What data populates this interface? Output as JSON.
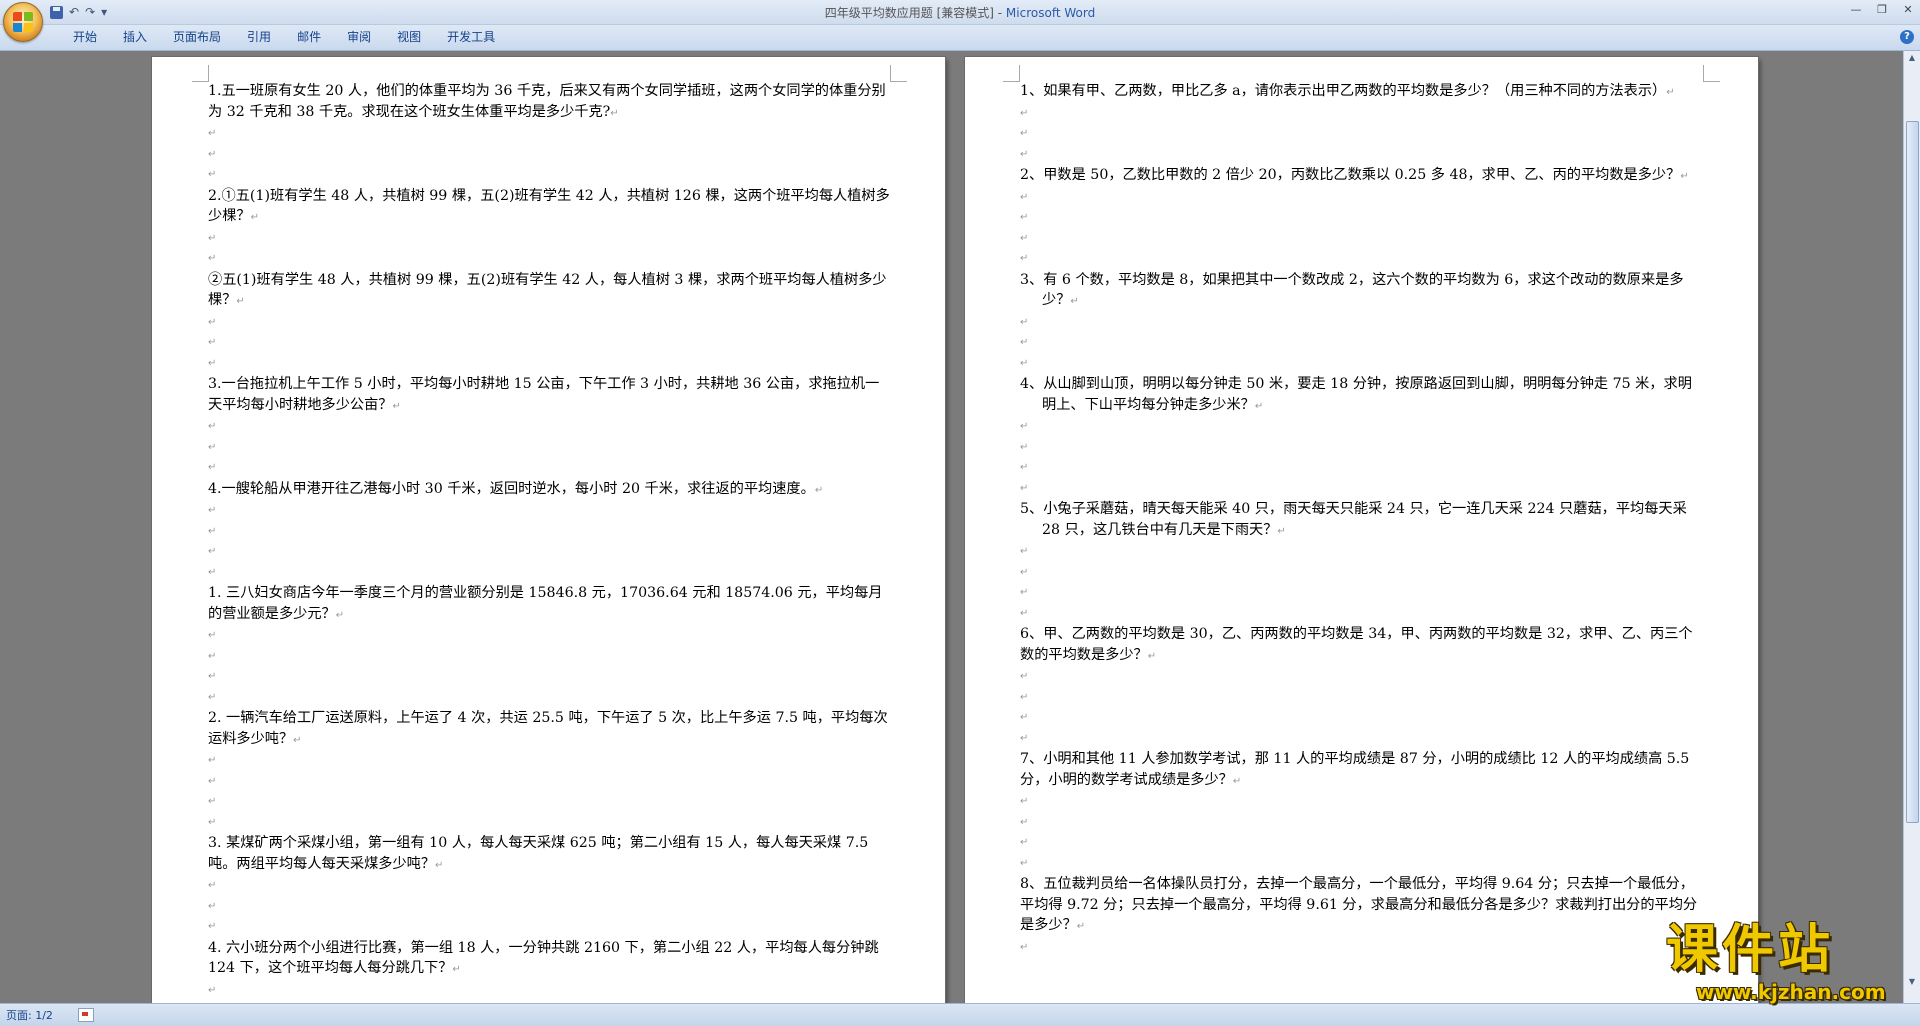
{
  "window": {
    "title_doc": "四年级平均数应用题 [兼容模式] - ",
    "title_app": "Microsoft Word",
    "qat": [
      "↶",
      "↷",
      "▾"
    ]
  },
  "ribbon": {
    "tabs": [
      "开始",
      "插入",
      "页面布局",
      "引用",
      "邮件",
      "审阅",
      "视图",
      "开发工具"
    ],
    "help": "?"
  },
  "page1": [
    {
      "t": "1.五一班原有女生 20 人，他们的体重平均为 36 千克，后来又有两个女同学插班，这两个女同学的体重分别为 32 千克和 38 千克。求现在这个班女生体重平均是多少千克?"
    },
    {
      "e": 1
    },
    {
      "e": 1
    },
    {
      "e": 1
    },
    {
      "t": "2.①五(1)班有学生 48 人，共植树 99 棵，五(2)班有学生 42 人，共植树 126 棵，这两个班平均每人植树多少棵？"
    },
    {
      "e": 1
    },
    {
      "e": 1
    },
    {
      "t": "②五(1)班有学生 48 人，共植树 99 棵，五(2)班有学生 42 人，每人植树 3 棵，求两个班平均每人植树多少棵？"
    },
    {
      "e": 1
    },
    {
      "e": 1
    },
    {
      "e": 1
    },
    {
      "t": "3.一台拖拉机上午工作 5 小时，平均每小时耕地 15 公亩，下午工作 3 小时，共耕地 36 公亩，求拖拉机一天平均每小时耕地多少公亩？"
    },
    {
      "e": 1
    },
    {
      "e": 1
    },
    {
      "e": 1
    },
    {
      "t": "4.一艘轮船从甲港开往乙港每小时 30 千米，返回时逆水，每小时 20 千米，求往返的平均速度。"
    },
    {
      "e": 1
    },
    {
      "e": 1
    },
    {
      "e": 1
    },
    {
      "e": 1
    },
    {
      "t": "1.  三八妇女商店今年一季度三个月的营业额分别是 15846.8 元，17036.64 元和 18574.06 元，平均每月的营业额是多少元？"
    },
    {
      "e": 1
    },
    {
      "e": 1
    },
    {
      "e": 1
    },
    {
      "e": 1
    },
    {
      "t": "2.  一辆汽车给工厂运送原料，上午运了 4 次，共运 25.5 吨，下午运了 5 次，比上午多运 7.5 吨，平均每次运料多少吨？"
    },
    {
      "e": 1
    },
    {
      "e": 1
    },
    {
      "e": 1
    },
    {
      "e": 1
    },
    {
      "t": "3.  某煤矿两个采煤小组，第一组有 10 人，每人每天采煤 625 吨；第二小组有 15 人，每人每天采煤 7.5 吨。两组平均每人每天采煤多少吨？"
    },
    {
      "e": 1
    },
    {
      "e": 1
    },
    {
      "e": 1
    },
    {
      "t": "4.  六小班分两个小组进行比赛，第一组 18 人，一分钟共跳 2160 下，第二小组 22 人，平均每人每分钟跳 124 下，这个班平均每人每分跳几下？"
    },
    {
      "e": 1
    },
    {
      "e": 1
    },
    {
      "e": 1
    },
    {
      "e": 1
    }
  ],
  "page2": [
    {
      "t": "1、如果有甲、乙两数，甲比乙多 a，请你表示出甲乙两数的平均数是多少？（用三种不同的方法表示）",
      "h": 1
    },
    {
      "e": 1
    },
    {
      "e": 1
    },
    {
      "e": 1
    },
    {
      "t": "2、甲数是 50，乙数比甲数的 2 倍少 20，丙数比乙数乘以 0.25 多 48，求甲、乙、丙的平均数是多少？",
      "h": 1
    },
    {
      "e": 1
    },
    {
      "e": 1
    },
    {
      "e": 1
    },
    {
      "e": 1
    },
    {
      "t": "3、有 6 个数，平均数是 8，如果把其中一个数改成 2，这六个数的平均数为 6，求这个改动的数原来是多少？",
      "h": 1
    },
    {
      "e": 1
    },
    {
      "e": 1
    },
    {
      "e": 1
    },
    {
      "t": "4、从山脚到山顶，明明以每分钟走 50 米，要走 18 分钟，按原路返回到山脚，明明每分钟走 75 米，求明明上、下山平均每分钟走多少米？",
      "h": 1
    },
    {
      "e": 1
    },
    {
      "e": 1
    },
    {
      "e": 1
    },
    {
      "e": 1
    },
    {
      "t": "5、小兔子采蘑菇，晴天每天能采 40 只，雨天每天只能采 24 只，它一连几天采 224 只蘑菇，平均每天采 28 只，这几铁台中有几天是下雨天？",
      "h": 1
    },
    {
      "e": 1
    },
    {
      "e": 1
    },
    {
      "e": 1
    },
    {
      "e": 1
    },
    {
      "t": "6、甲、乙两数的平均数是 30，乙、丙两数的平均数是 34，甲、丙两数的平均数是 32，求甲、乙、丙三个数的平均数是多少？"
    },
    {
      "e": 1
    },
    {
      "e": 1
    },
    {
      "e": 1
    },
    {
      "e": 1
    },
    {
      "t": "7、小明和其他 11 人参加数学考试，那 11 人的平均成绩是 87 分，小明的成绩比 12 人的平均成绩高 5.5 分，小明的数学考试成绩是多少？"
    },
    {
      "e": 1
    },
    {
      "e": 1
    },
    {
      "e": 1
    },
    {
      "e": 1
    },
    {
      "t": "8、五位裁判员给一名体操队员打分，去掉一个最高分，一个最低分，平均得 9.64 分；只去掉一个最低分，平均得 9.72 分；只去掉一个最高分，平均得 9.61 分，求最高分和最低分各是多少？求裁判打出分的平均分是多少？"
    },
    {
      "e": 1
    }
  ],
  "status": {
    "page": "页面: 1/2"
  },
  "watermark": {
    "cn": "课件站",
    "url": "www.kjzhan.com"
  },
  "icons": {
    "office": "office-logo-icon",
    "save": "save-icon",
    "paragraph_mark": "↵"
  }
}
